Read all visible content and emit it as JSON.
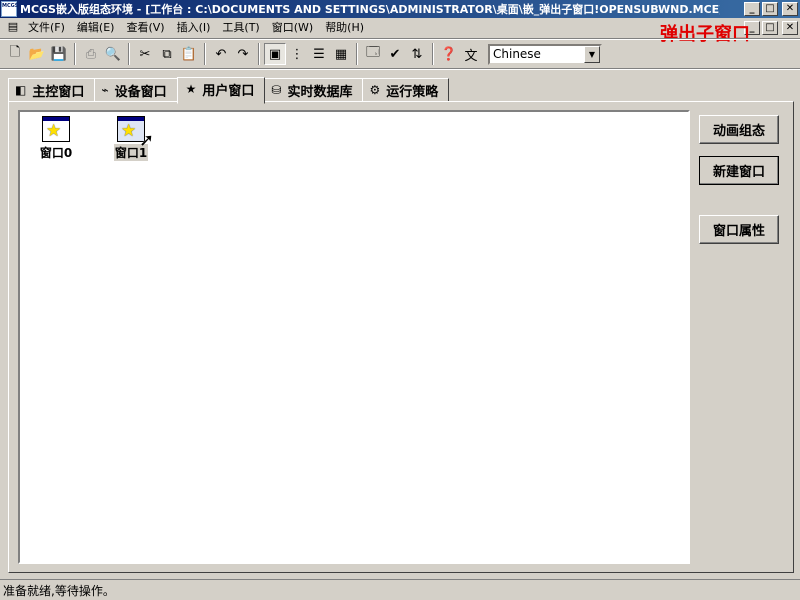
{
  "window": {
    "app_icon_text": "MCGS",
    "title": "MCGS嵌入版组态环境 - [工作台 : C:\\DOCUMENTS AND SETTINGS\\ADMINISTRATOR\\桌面\\嵌_弹出子窗口!OPENSUBWND.MCE]",
    "minimize": "_",
    "maximize": "□",
    "close": "✕"
  },
  "watermark": "弹出子窗口",
  "menu": {
    "items": [
      "文件(F)",
      "编辑(E)",
      "查看(V)",
      "插入(I)",
      "工具(T)",
      "窗口(W)",
      "帮助(H)"
    ]
  },
  "toolbar": {
    "language": "Chinese"
  },
  "tabs": [
    {
      "label": "主控窗口",
      "icon": "main-window-icon"
    },
    {
      "label": "设备窗口",
      "icon": "device-window-icon"
    },
    {
      "label": "用户窗口",
      "icon": "user-window-icon"
    },
    {
      "label": "实时数据库",
      "icon": "database-icon"
    },
    {
      "label": "运行策略",
      "icon": "strategy-icon"
    }
  ],
  "active_tab": "用户窗口",
  "user_windows": [
    {
      "label": "窗口0"
    },
    {
      "label": "窗口1"
    }
  ],
  "side_buttons": {
    "animation": "动画组态",
    "new_window": "新建窗口",
    "properties": "窗口属性"
  },
  "status": "准备就绪,等待操作。"
}
